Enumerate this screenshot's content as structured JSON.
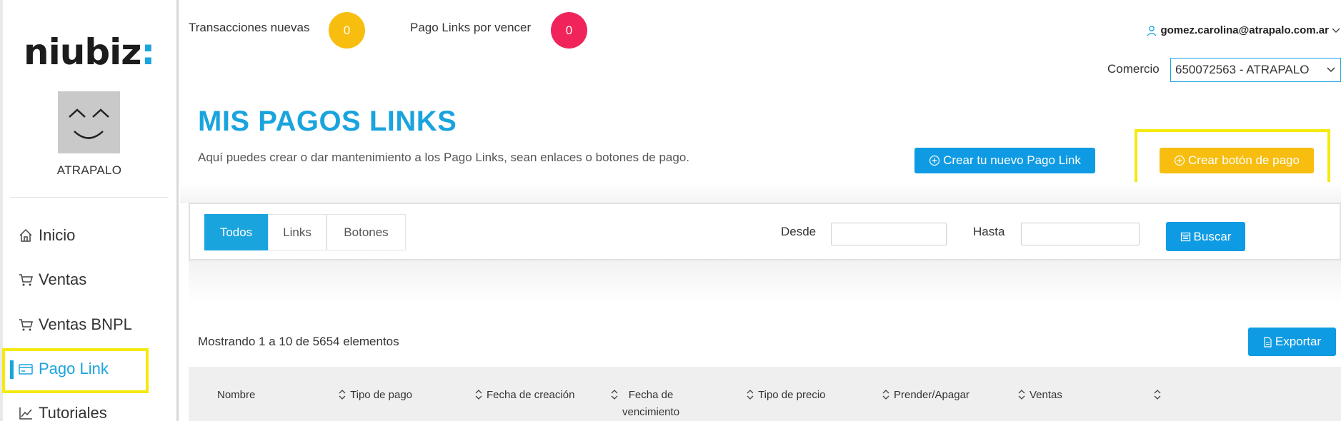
{
  "brand": {
    "logo_text": "niubiz",
    "logo_colon": ":",
    "accent": "#1aa4de"
  },
  "sidebar": {
    "merchant_name": "ATRAPALO",
    "items": [
      {
        "label": "Inicio",
        "icon": "home-icon"
      },
      {
        "label": "Ventas",
        "icon": "cart-icon"
      },
      {
        "label": "Ventas BNPL",
        "icon": "cart-icon"
      },
      {
        "label": "Pago Link",
        "icon": "card-icon",
        "active": true
      },
      {
        "label": "Tutoriales",
        "icon": "chart-icon"
      }
    ]
  },
  "topbar": {
    "new_transactions_label": "Transacciones nuevas",
    "new_transactions_count": "0",
    "expiring_links_label": "Pago Links por vencer",
    "expiring_links_count": "0",
    "user_email": "gomez.carolina@atrapalo.com.ar",
    "comercio_label": "Comercio",
    "comercio_value": "650072563 - ATRAPALO"
  },
  "header": {
    "title": "MIS PAGOS LINKS",
    "subtitle": "Aquí puedes crear o dar mantenimiento a los Pago Links, sean enlaces o botones de pago.",
    "create_link_label": "Crear tu nuevo Pago Link",
    "create_button_label": "Crear botón de pago"
  },
  "filters": {
    "tabs": [
      "Todos",
      "Links",
      "Botones"
    ],
    "active_tab": "Todos",
    "desde_label": "Desde",
    "desde_value": "",
    "hasta_label": "Hasta",
    "hasta_value": "",
    "search_label": "Buscar"
  },
  "table": {
    "showing_text": "Mostrando 1 a 10 de 5654 elementos",
    "export_label": "Exportar",
    "columns": [
      "Nombre",
      "Tipo de pago",
      "Fecha de creación",
      "Fecha de\nvencimiento",
      "Tipo de precio",
      "Prender/Apagar",
      "Ventas",
      ""
    ]
  },
  "colors": {
    "primary_blue": "#1aa4de",
    "button_blue": "#0f9be3",
    "badge_yellow": "#f7bd0f",
    "badge_red": "#f0245b",
    "highlight_yellow": "#f5e90f"
  }
}
